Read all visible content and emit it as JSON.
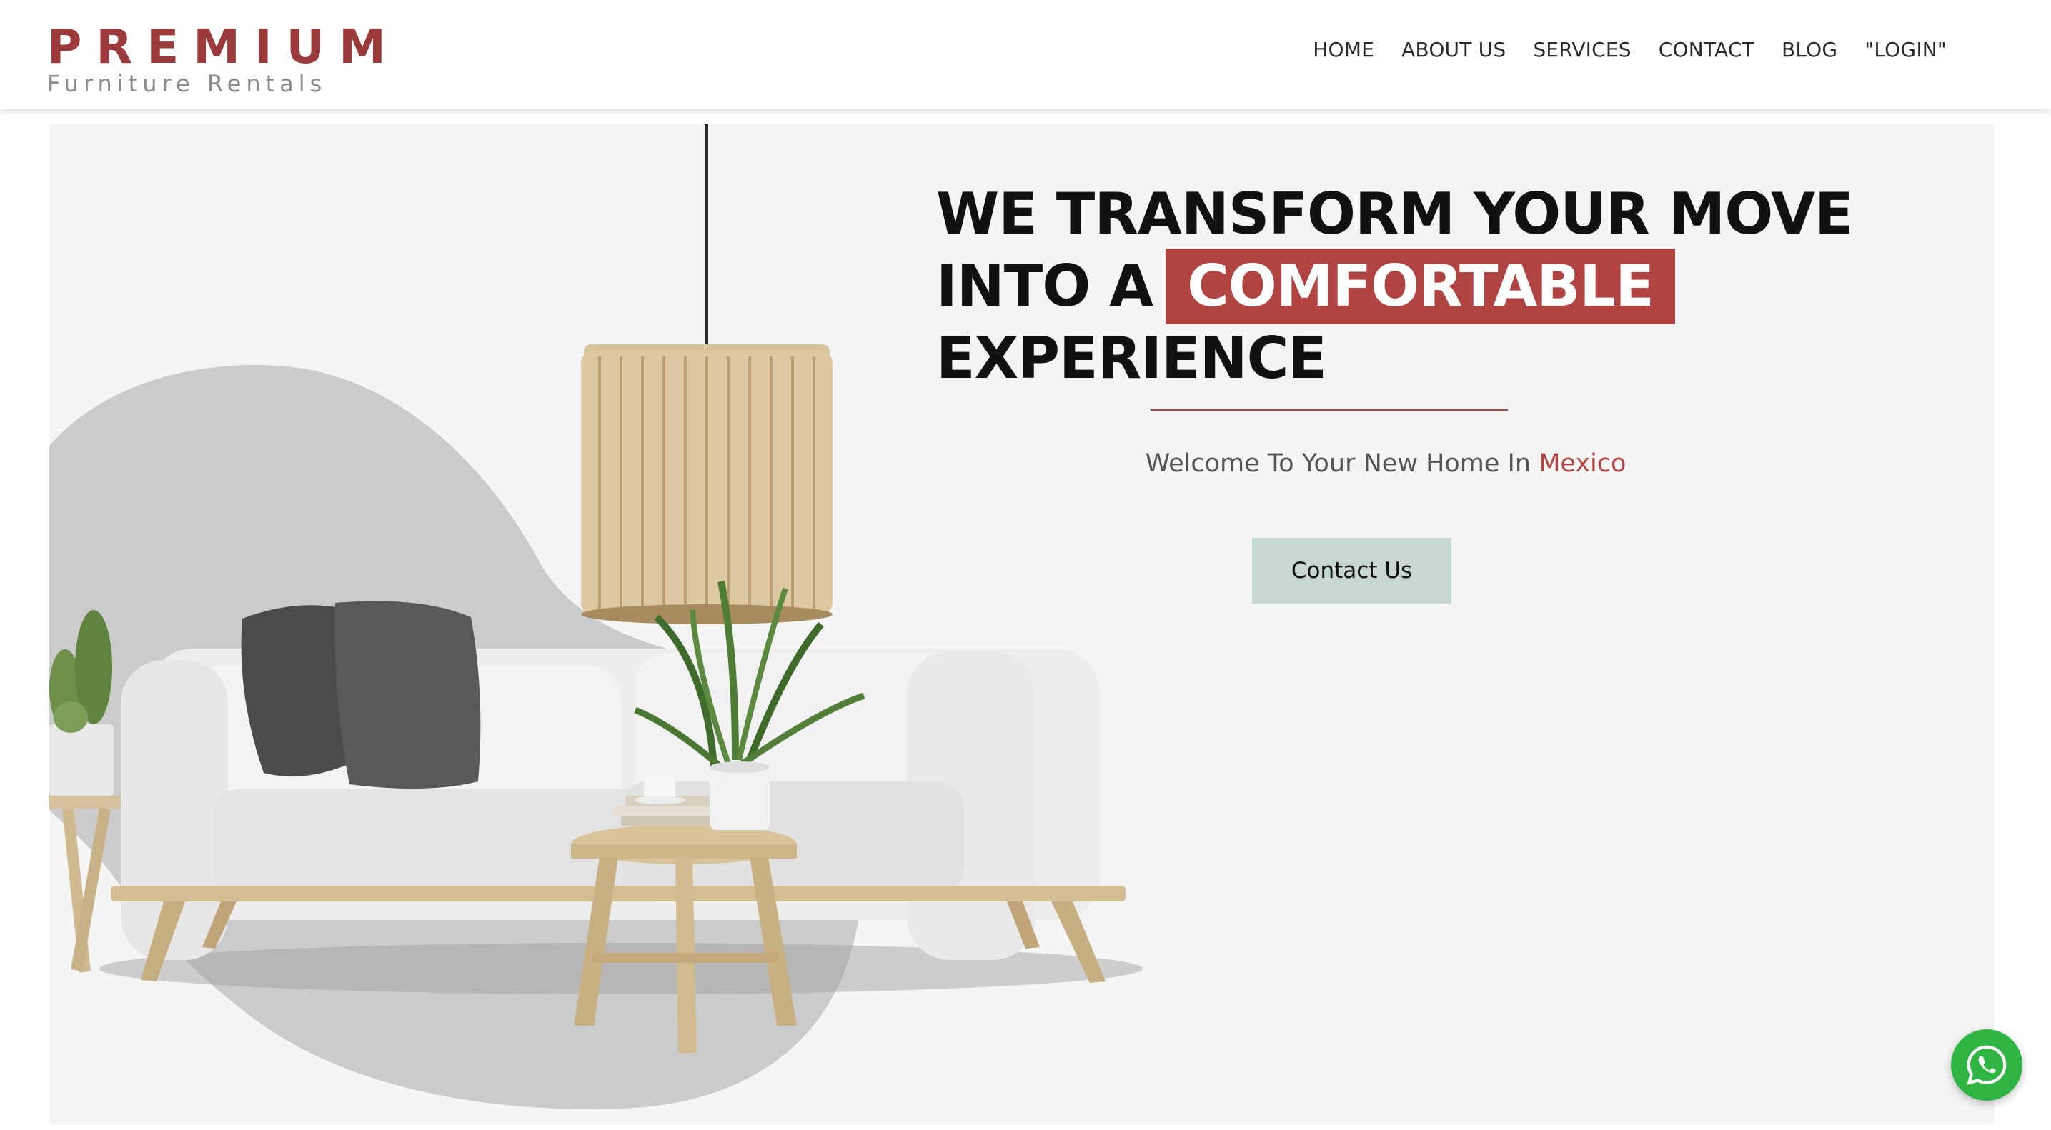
{
  "brand": {
    "name": "PREMIUM",
    "tagline": "Furniture Rentals",
    "accent_color": "#9b3a3b"
  },
  "nav": {
    "items": [
      {
        "label": "HOME"
      },
      {
        "label": "ABOUT US"
      },
      {
        "label": "SERVICES"
      },
      {
        "label": "CONTACT"
      },
      {
        "label": "BLOG"
      },
      {
        "label": "\"LOGIN\""
      }
    ]
  },
  "hero": {
    "headline_line1": "WE TRANSFORM YOUR MOVE",
    "headline_line2_prefix": "INTO A",
    "headline_highlight": "COMFORTABLE",
    "headline_line3": "EXPERIENCE",
    "welcome_prefix": "Welcome To Your New Home In",
    "welcome_accent": "Mexico",
    "cta_label": "Contact Us",
    "highlight_color": "#b04442",
    "cta_color": "#c7d7d2"
  },
  "floating": {
    "whatsapp_icon": "whatsapp-icon",
    "whatsapp_color": "#2fb543"
  }
}
